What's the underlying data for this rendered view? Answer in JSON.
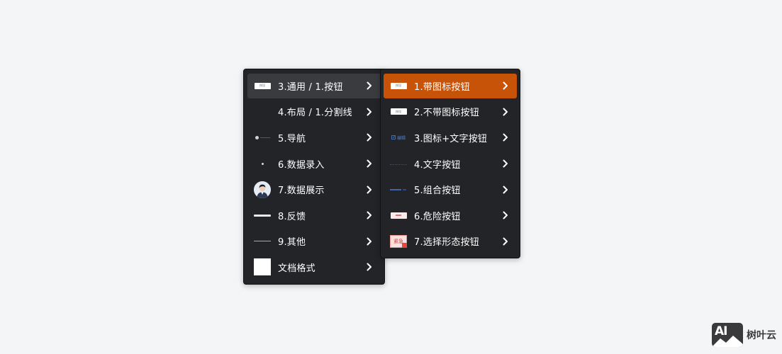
{
  "menu_level1": {
    "items": [
      {
        "label": "3.通用 / 1.按钮",
        "thumb": "button-preview",
        "thumb_text": "按钮",
        "state": "hover"
      },
      {
        "label": "4.布局 / 1.分割线",
        "thumb": "none"
      },
      {
        "label": "5.导航",
        "thumb": "navigation-preview"
      },
      {
        "label": "6.数据录入",
        "thumb": "dot-preview"
      },
      {
        "label": "7.数据展示",
        "thumb": "avatar-preview"
      },
      {
        "label": "8.反馈",
        "thumb": "thick-line-preview"
      },
      {
        "label": "9.其他",
        "thumb": "thin-line-preview"
      },
      {
        "label": "文档格式",
        "thumb": "white-square-preview"
      }
    ]
  },
  "menu_level2": {
    "items": [
      {
        "label": "1.带图标按钮",
        "thumb": "icon-button-preview",
        "thumb_text": "按钮",
        "state": "active"
      },
      {
        "label": "2.不带图标按钮",
        "thumb": "button-preview",
        "thumb_text": "按钮"
      },
      {
        "label": "3.图标+文字按钮",
        "thumb": "edit-icon-text-preview",
        "thumb_text": "编辑"
      },
      {
        "label": "4.文字按钮",
        "thumb": "text-button-preview"
      },
      {
        "label": "5.组合按钮",
        "thumb": "group-button-preview"
      },
      {
        "label": "6.危险按钮",
        "thumb": "danger-button-preview"
      },
      {
        "label": "7.选择形态按钮",
        "thumb": "select-state-preview",
        "thumb_text": "紧急"
      }
    ]
  },
  "icons": {
    "submenu": "chevron-right-icon"
  },
  "colors": {
    "page_bg": "#f4f5f7",
    "menu_bg": "#232427",
    "hover_bg": "#3a3b3f",
    "active_bg": "#c65307",
    "text": "#ffffff"
  },
  "watermark": {
    "logo_text": "AI",
    "brand": "树叶云"
  }
}
